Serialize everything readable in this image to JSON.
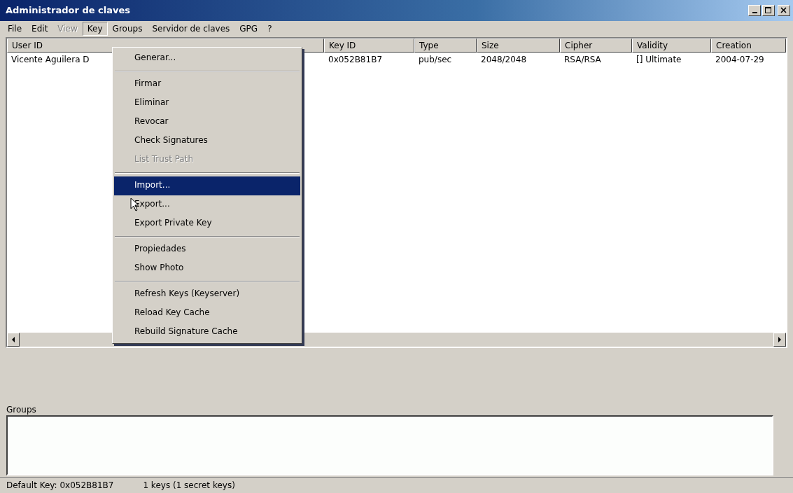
{
  "window": {
    "title": "Administrador de claves"
  },
  "menubar": [
    {
      "label": "File",
      "disabled": false,
      "selected": false
    },
    {
      "label": "Edit",
      "disabled": false,
      "selected": false
    },
    {
      "label": "View",
      "disabled": true,
      "selected": false
    },
    {
      "label": "Key",
      "disabled": false,
      "selected": true
    },
    {
      "label": "Groups",
      "disabled": false,
      "selected": false
    },
    {
      "label": "Servidor de claves",
      "disabled": false,
      "selected": false
    },
    {
      "label": "GPG",
      "disabled": false,
      "selected": false
    },
    {
      "label": "?",
      "disabled": false,
      "selected": false
    }
  ],
  "key_menu": [
    {
      "kind": "item",
      "label": "Generar...",
      "disabled": false,
      "selected": false
    },
    {
      "kind": "separator"
    },
    {
      "kind": "item",
      "label": "Firmar",
      "disabled": false,
      "selected": false
    },
    {
      "kind": "item",
      "label": "Eliminar",
      "disabled": false,
      "selected": false
    },
    {
      "kind": "item",
      "label": "Revocar",
      "disabled": false,
      "selected": false
    },
    {
      "kind": "item",
      "label": "Check Signatures",
      "disabled": false,
      "selected": false
    },
    {
      "kind": "item",
      "label": "List Trust Path",
      "disabled": true,
      "selected": false
    },
    {
      "kind": "separator"
    },
    {
      "kind": "item",
      "label": "Import...",
      "disabled": false,
      "selected": true
    },
    {
      "kind": "item",
      "label": "Export...",
      "disabled": false,
      "selected": false
    },
    {
      "kind": "item",
      "label": "Export Private Key",
      "disabled": false,
      "selected": false
    },
    {
      "kind": "separator"
    },
    {
      "kind": "item",
      "label": "Propiedades",
      "disabled": false,
      "selected": false
    },
    {
      "kind": "item",
      "label": "Show Photo",
      "disabled": false,
      "selected": false
    },
    {
      "kind": "separator"
    },
    {
      "kind": "item",
      "label": "Refresh Keys (Keyserver)",
      "disabled": false,
      "selected": false
    },
    {
      "kind": "item",
      "label": "Reload Key Cache",
      "disabled": false,
      "selected": false
    },
    {
      "kind": "item",
      "label": "Rebuild Signature Cache",
      "disabled": false,
      "selected": false
    }
  ],
  "table": {
    "columns": [
      "User ID",
      "Key ID",
      "Type",
      "Size",
      "Cipher",
      "Validity",
      "Creation"
    ],
    "rows": [
      {
        "cells": [
          "Vicente Aguilera D",
          "0x052B81B7",
          "pub/sec",
          "2048/2048",
          "RSA/RSA",
          "[] Ultimate",
          "2004-07-29"
        ]
      }
    ]
  },
  "groups": {
    "label": "Groups"
  },
  "status_bar": [
    "Default Key: 0x052B81B7",
    "1 keys (1 secret keys)"
  ]
}
